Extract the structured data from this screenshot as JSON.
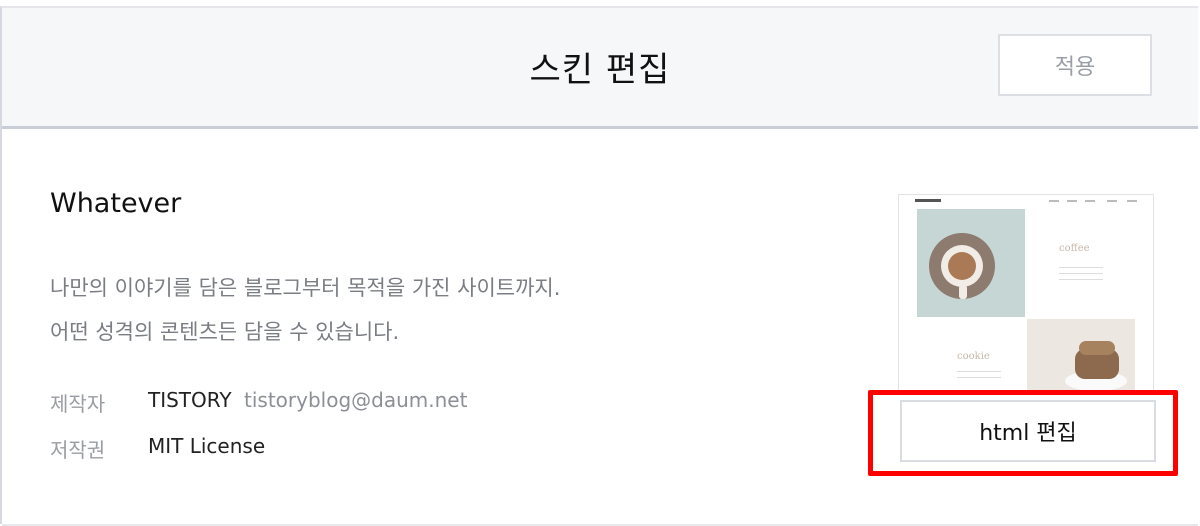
{
  "header": {
    "title": "스킨 편집",
    "apply_label": "적용"
  },
  "skin": {
    "name": "Whatever",
    "description_line1": "나만의 이야기를 담은 블로그부터 목적을 가진 사이트까지.",
    "description_line2": "어떤 성격의 콘텐츠든 담을 수 있습니다.",
    "author_label": "제작자",
    "author_name": "TISTORY",
    "author_email": "tistoryblog@daum.net",
    "license_label": "저작권",
    "license_value": "MIT License"
  },
  "preview": {
    "coffee_text": "coffee",
    "cookie_text": "cookie"
  },
  "actions": {
    "html_edit_label": "html 편집"
  },
  "colors": {
    "highlight": "#ff0000",
    "header_bg": "#f6f7f9"
  }
}
